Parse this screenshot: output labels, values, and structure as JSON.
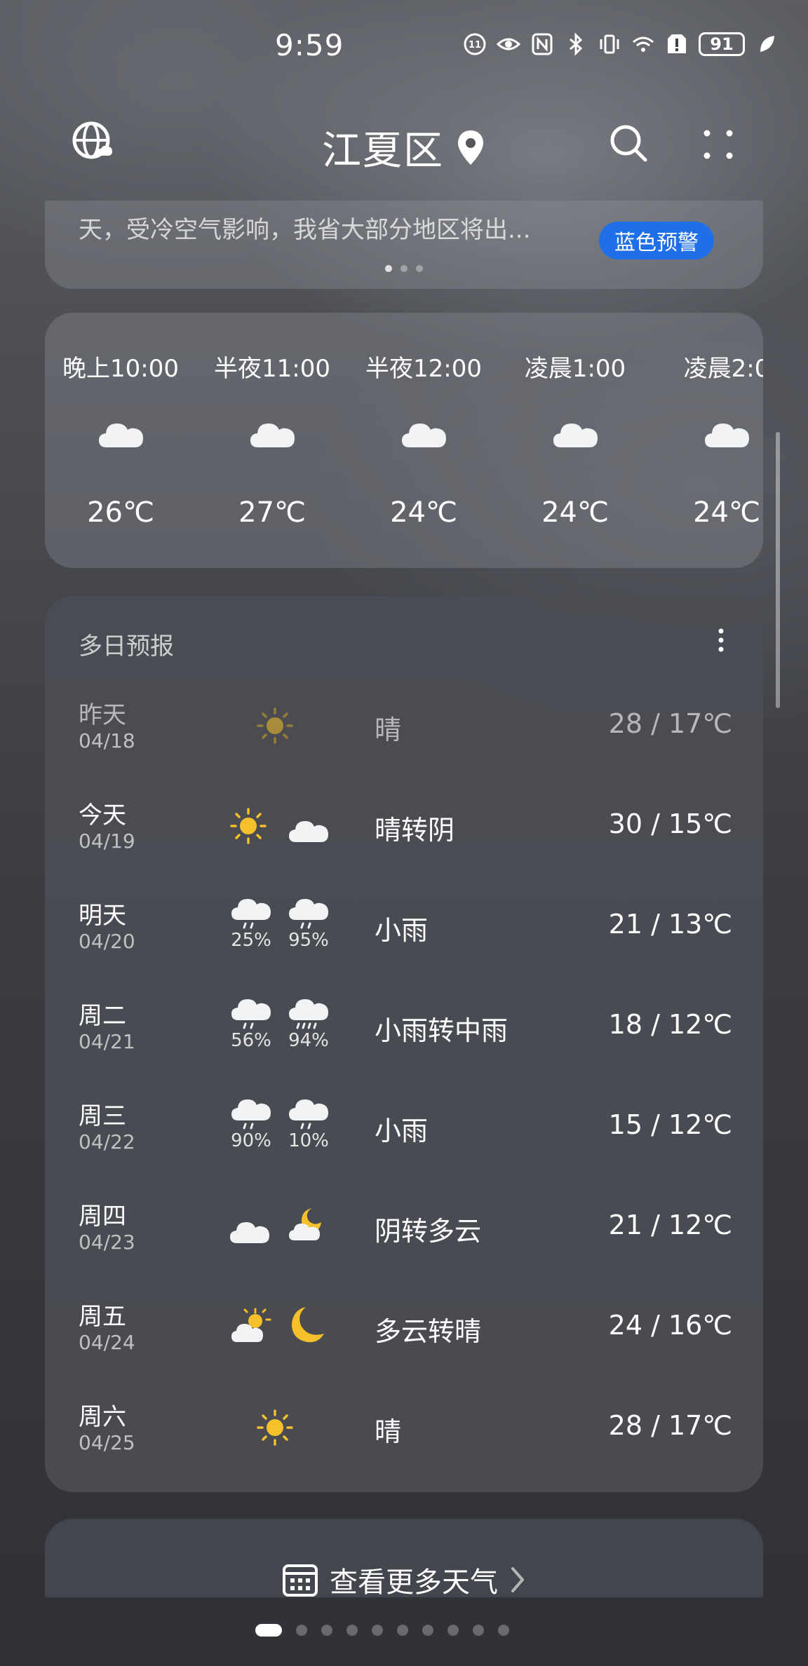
{
  "status_bar": {
    "time": "9:59",
    "battery": "91"
  },
  "header": {
    "location": "江夏区"
  },
  "alert": {
    "text": "天，受冷空气影响，我省大部分地区将出...",
    "badge": "蓝色预警",
    "badge_color": "#1f6fe8"
  },
  "hourly": [
    {
      "time": "晚上10:00",
      "icon": "cloudy-icon",
      "temp": "26℃"
    },
    {
      "time": "半夜11:00",
      "icon": "cloudy-icon",
      "temp": "27℃"
    },
    {
      "time": "半夜12:00",
      "icon": "cloudy-icon",
      "temp": "24℃"
    },
    {
      "time": "凌晨1:00",
      "icon": "cloudy-icon",
      "temp": "24℃"
    },
    {
      "time": "凌晨2:0",
      "icon": "cloudy-icon",
      "temp": "24℃"
    }
  ],
  "forecast": {
    "title": "多日预报",
    "days": [
      {
        "day": "昨天",
        "date": "04/18",
        "cond": "晴",
        "temp": "28 / 17℃",
        "icons": [
          "sun-icon"
        ],
        "pops": []
      },
      {
        "day": "今天",
        "date": "04/19",
        "cond": "晴转阴",
        "temp": "30 / 15℃",
        "icons": [
          "sun-icon",
          "cloudy-icon"
        ],
        "pops": []
      },
      {
        "day": "明天",
        "date": "04/20",
        "cond": "小雨",
        "temp": "21 / 13℃",
        "icons": [
          "light-rain-icon",
          "light-rain-icon"
        ],
        "pops": [
          "25%",
          "95%"
        ]
      },
      {
        "day": "周二",
        "date": "04/21",
        "cond": "小雨转中雨",
        "temp": "18 / 12℃",
        "icons": [
          "light-rain-icon",
          "moderate-rain-icon"
        ],
        "pops": [
          "56%",
          "94%"
        ]
      },
      {
        "day": "周三",
        "date": "04/22",
        "cond": "小雨",
        "temp": "15 / 12℃",
        "icons": [
          "light-rain-icon",
          "light-rain-icon"
        ],
        "pops": [
          "90%",
          "10%"
        ]
      },
      {
        "day": "周四",
        "date": "04/23",
        "cond": "阴转多云",
        "temp": "21 / 12℃",
        "icons": [
          "cloudy-icon",
          "partly-cloudy-night-icon"
        ],
        "pops": []
      },
      {
        "day": "周五",
        "date": "04/24",
        "cond": "多云转晴",
        "temp": "24 / 16℃",
        "icons": [
          "partly-cloudy-day-icon",
          "moon-icon"
        ],
        "pops": []
      },
      {
        "day": "周六",
        "date": "04/25",
        "cond": "晴",
        "temp": "28 / 17℃",
        "icons": [
          "sun-icon"
        ],
        "pops": []
      }
    ]
  },
  "more": {
    "label": "查看更多天气"
  },
  "page_dots": {
    "count": 10,
    "active": 0
  }
}
